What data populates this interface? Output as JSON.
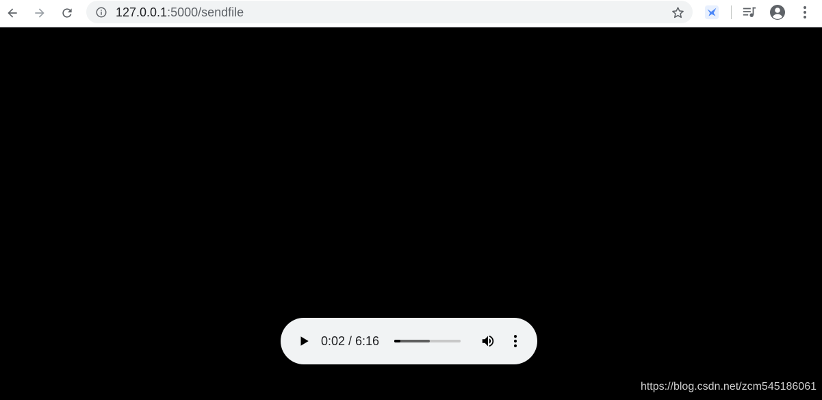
{
  "browser": {
    "url_host": "127.0.0.1",
    "url_path": ":5000/sendfile",
    "icons": {
      "back": "arrow-left-icon",
      "forward": "arrow-right-icon",
      "reload": "reload-icon",
      "site_info": "info-icon",
      "bookmark": "star-icon",
      "extension": "extension-bird-icon",
      "media": "media-queue-icon",
      "profile": "account-circle-icon",
      "menu": "kebab-menu-icon"
    },
    "colors": {
      "toolbar_bg": "#ffffff",
      "omnibox_bg": "#f1f3f4",
      "icon": "#5f6368",
      "extension_accent": "#4a86f7"
    }
  },
  "player": {
    "time_display": "0:02 / 6:16",
    "progress_played_fraction": 0.09,
    "progress_buffered_fraction": 0.54,
    "icons": {
      "play": "play-icon",
      "volume": "volume-icon",
      "more": "more-options-icon"
    },
    "colors": {
      "background": "#f1f3f4",
      "track": "#c8c8c8",
      "played": "#000000"
    }
  },
  "watermark": {
    "text": "https://blog.csdn.net/zcm545186061"
  }
}
